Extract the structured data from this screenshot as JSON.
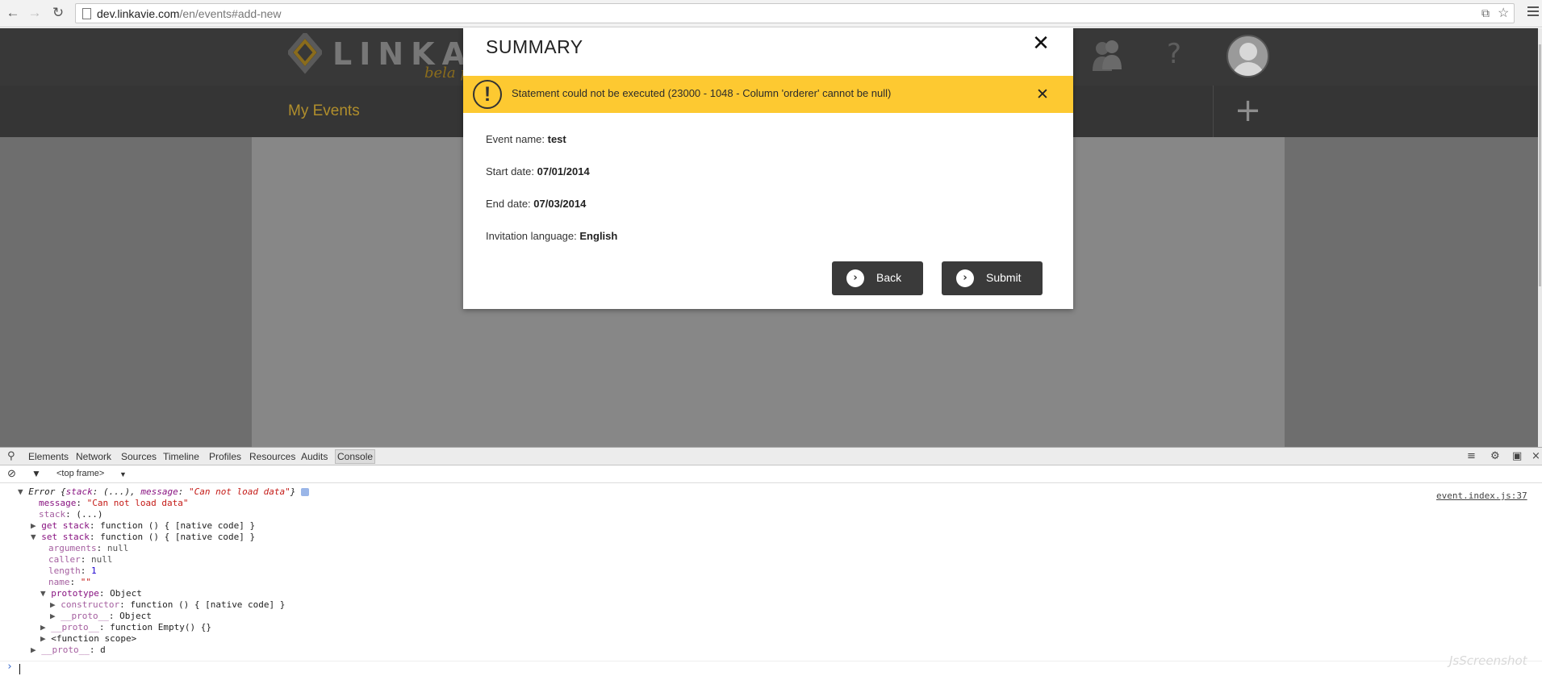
{
  "browser": {
    "url_host": "dev.linkavie.com",
    "url_path": "/en/events#add-new",
    "back_glyph": "←",
    "forward_glyph": "→",
    "reload_glyph": "↻",
    "star_glyph": "☆",
    "ext_glyph": "⧉"
  },
  "site": {
    "logo_text": "LINKAV",
    "tagline": "bela pr",
    "my_events": "My Events",
    "help_glyph": "?",
    "plus_glyph": "+"
  },
  "modal": {
    "title": "SUMMARY",
    "close_glyph": "✕",
    "alert_icon_glyph": "!",
    "alert_text": "Statement could not be executed (23000 - 1048 - Column 'orderer' cannot be null)",
    "alert_close_glyph": "✕",
    "fields": [
      {
        "label": "Event name:",
        "value": "test"
      },
      {
        "label": "Start date:",
        "value": "07/01/2014"
      },
      {
        "label": "End date:",
        "value": "07/03/2014"
      },
      {
        "label": "Invitation language:",
        "value": "English"
      }
    ],
    "back_label": "Back",
    "submit_label": "Submit",
    "btn_glyph": "›"
  },
  "devtools": {
    "tabs": [
      "Elements",
      "Network",
      "Sources",
      "Timeline",
      "Profiles",
      "Resources",
      "Audits",
      "Console"
    ],
    "active_tab": "Console",
    "frame_select": "<top frame>",
    "file_link": "event.index.js:37",
    "console": {
      "l1_a": "Error {",
      "l1_b": "stack",
      "l1_c": ": (...), ",
      "l1_d": "message",
      "l1_e": ": ",
      "l1_f": "\"Can not load data\"",
      "l1_g": "}",
      "l2_k": "message",
      "l2_v": "\"Can not load data\"",
      "l3_k": "stack",
      "l3_v": "(...)",
      "l4_k": "get stack",
      "l4_v": "function () { [native code] }",
      "l5_k": "set stack",
      "l5_v": "function () { [native code] }",
      "l6_k": "arguments",
      "l6_v": "null",
      "l7_k": "caller",
      "l7_v": "null",
      "l8_k": "length",
      "l8_v": "1",
      "l9_k": "name",
      "l9_v": "\"\"",
      "l10_k": "prototype",
      "l10_v": "Object",
      "l11_k": "constructor",
      "l11_v": "function () { [native code] }",
      "l12_k": "__proto__",
      "l12_v": "Object",
      "l13_k": "__proto__",
      "l13_v": "function Empty() {}",
      "l14": "<function scope>",
      "l15_k": "__proto__",
      "l15_v": "d",
      "sep": ": "
    },
    "prompt_glyph": "›"
  },
  "watermark": "JsScreenshot",
  "colors": {
    "alert_bg": "#fdc931",
    "header_bg": "#383838",
    "accent_gold": "#b08e2c",
    "button_bg": "#3a3a3a"
  }
}
